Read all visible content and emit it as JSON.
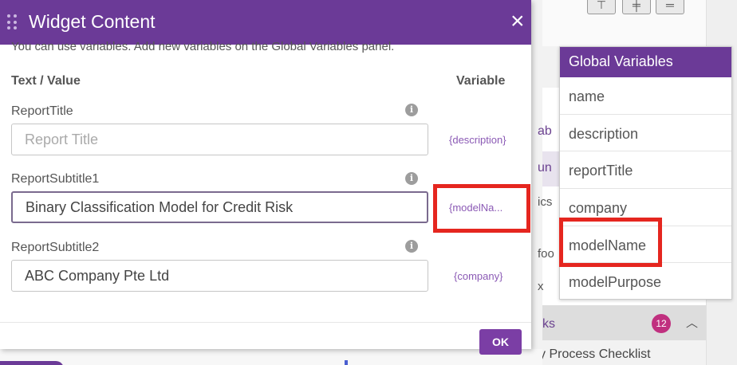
{
  "dialog": {
    "title": "Widget Content",
    "hint": "You can use variables. Add new variables on the Global Variables panel.",
    "col_text": "Text / Value",
    "col_variable": "Variable",
    "fields": [
      {
        "label": "ReportTitle",
        "value": "",
        "placeholder": "Report Title",
        "variable": "{description}"
      },
      {
        "label": "ReportSubtitle1",
        "value": "Binary Classification Model for Credit Risk",
        "placeholder": "",
        "variable": "{modelNa..."
      },
      {
        "label": "ReportSubtitle2",
        "value": "ABC Company Pte Ltd",
        "placeholder": "",
        "variable": "{company}"
      }
    ],
    "ok_label": "OK"
  },
  "global_variables": {
    "title": "Global Variables",
    "items": [
      "name",
      "description",
      "reportTitle",
      "company",
      "modelName",
      "modelPurpose"
    ]
  },
  "background": {
    "frag_ab": "ab",
    "frag_un": "un",
    "frag_ics": "ics",
    "frag_foo": "foo",
    "frag_x": "x",
    "tasks": "ks",
    "badge": "12",
    "checklist": "y Process Checklist"
  },
  "colors": {
    "header": "#6b3a97",
    "accent": "#7b3ea5",
    "highlight": "#e5261f",
    "badge": "#c0307f"
  },
  "icons": [
    "drag-handle-icon",
    "close-icon",
    "info-icon",
    "chevron-up-icon"
  ]
}
